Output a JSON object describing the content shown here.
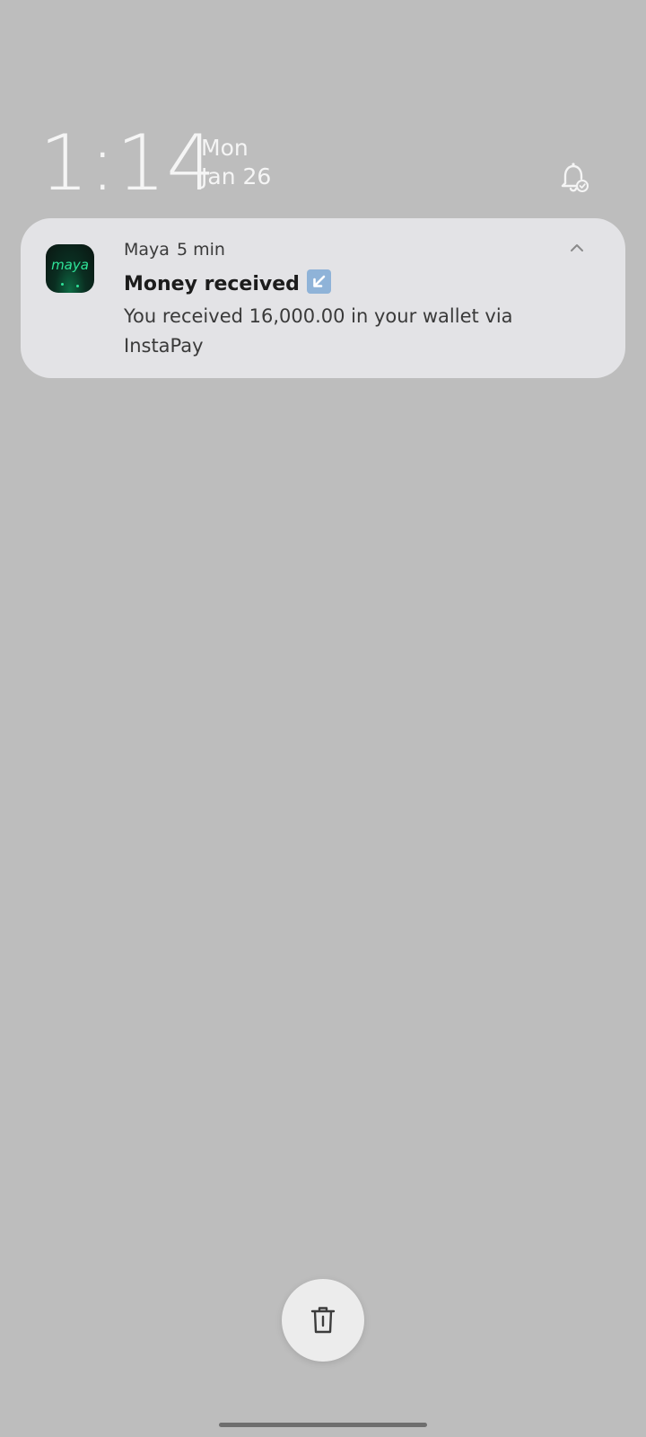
{
  "lockscreen": {
    "time": "1:14",
    "day": "Mon",
    "date": "Jan 26"
  },
  "notification": {
    "app_name": "Maya",
    "app_icon_text": "maya",
    "time_ago": "5 min",
    "title": "Money received",
    "title_emoji": "arrow-lower-left-icon",
    "body": "You received 16,000.00 in your wallet via InstaPay"
  },
  "icons": {
    "bell": "notification-settings-bell-icon",
    "chevron": "chevron-up-icon",
    "delete": "trash-icon"
  },
  "colors": {
    "background": "#bdbdbd",
    "card": "#e3e3e6",
    "maya_green": "#2fe398",
    "clock_text": "#f5f5f5"
  }
}
